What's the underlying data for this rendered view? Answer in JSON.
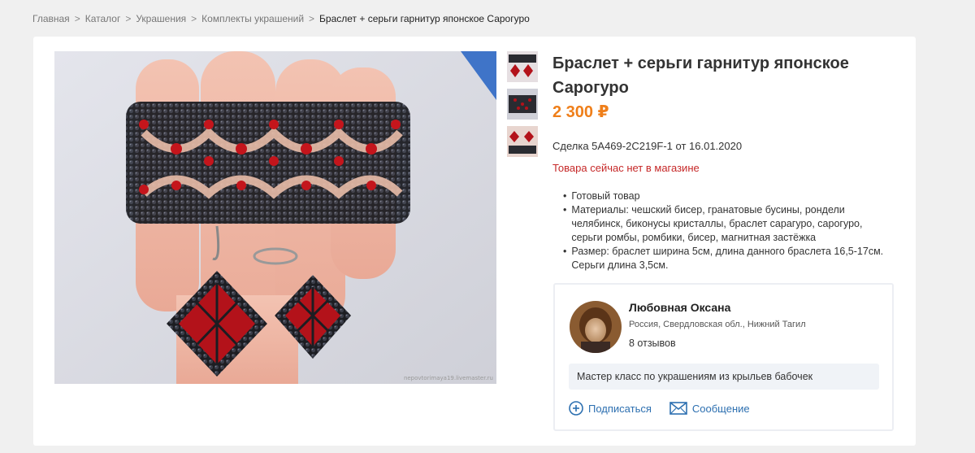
{
  "breadcrumb": {
    "items": [
      "Главная",
      "Каталог",
      "Украшения",
      "Комплекты украшений"
    ],
    "separator": ">",
    "current": "Браслет + серьги гарнитур японское Сарогуро"
  },
  "product": {
    "title": "Браслет + серьги гарнитур японское Сарогуро",
    "price": "2 300 ₽",
    "deal": "Сделка 5A469-2C219F-1 от 16.01.2020",
    "stock_status": "Товара сейчас нет в магазине",
    "photo_watermark": "nepovtorimaya19.livemaster.ru",
    "details": [
      "Готовый товар",
      "Материалы: чешский бисер, гранатовые бусины, рондели челябинск, биконусы кристаллы, браслет сарагуро, сарогуро, серьги ромбы, ромбики, бисер, магнитная застёжка",
      "Размер: браслет ширина 5см, длина данного браслета 16,5-17см. Серьги длина 3,5см."
    ],
    "bullet": "•",
    "thumbnail_count": 3
  },
  "seller": {
    "name": "Любовная Оксана",
    "location": "Россия, Свердловская обл., Нижний Тагил",
    "reviews": "8 отзывов",
    "master_class": "Мастер класс по украшениям из крыльев бабочек",
    "subscribe_label": "Подписаться",
    "message_label": "Сообщение"
  },
  "colors": {
    "price": "#ef7f1a",
    "stock_warning": "#c62828",
    "link": "#2c6fb0",
    "bead_red": "#c4151c"
  }
}
